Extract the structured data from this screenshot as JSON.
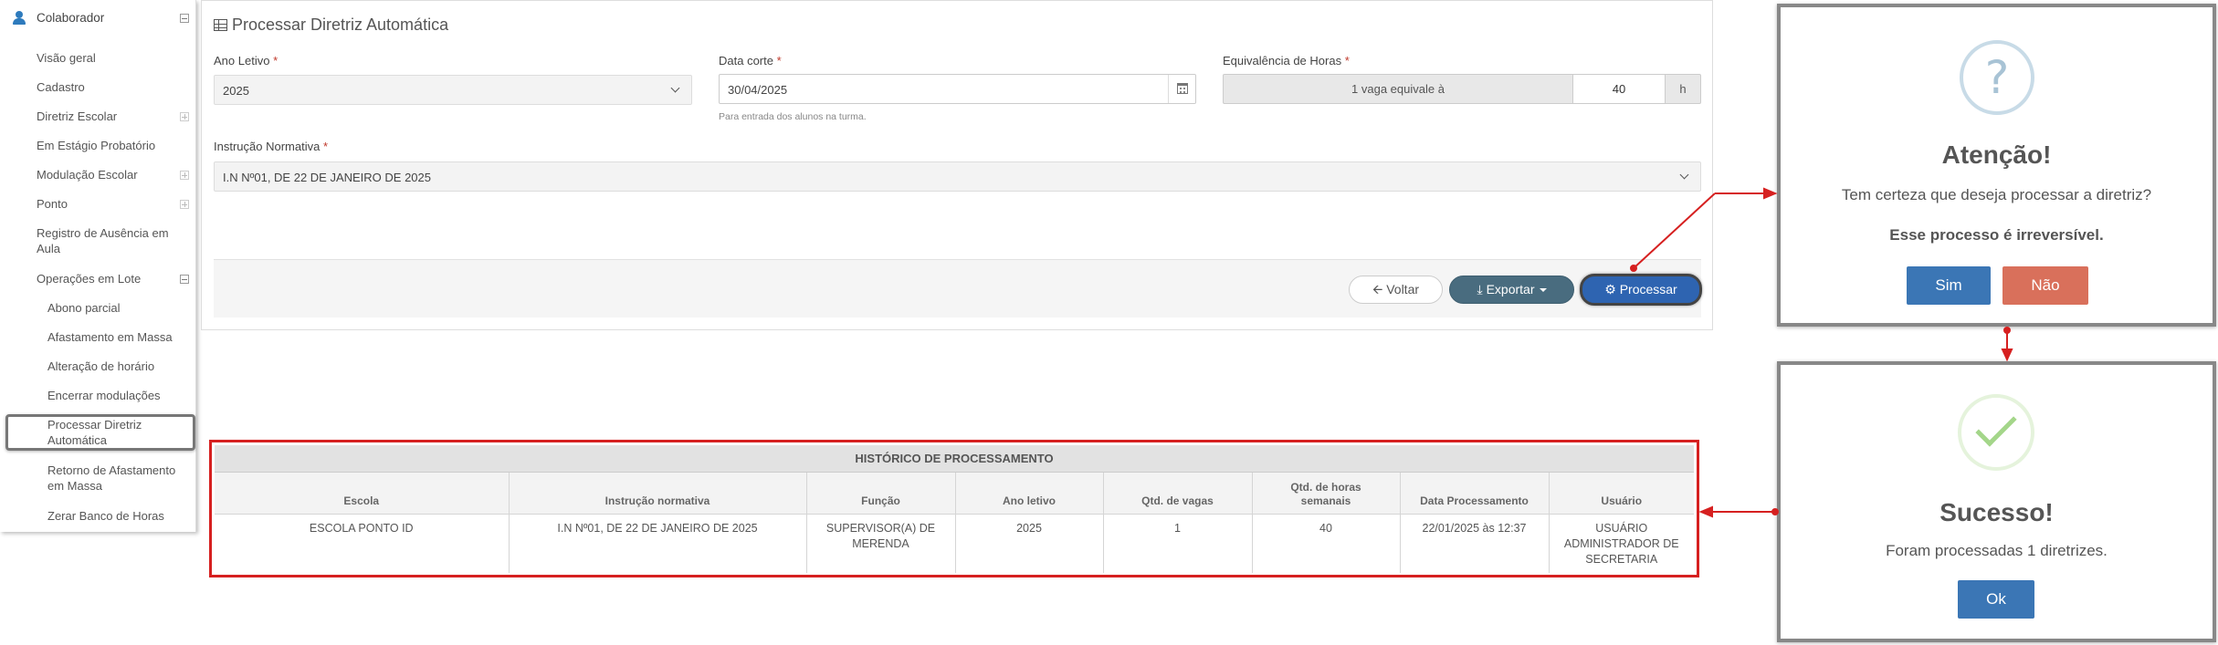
{
  "sidebar": {
    "header": "Colaborador",
    "items": [
      {
        "label": "Visão geral"
      },
      {
        "label": "Cadastro"
      },
      {
        "label": "Diretriz Escolar"
      },
      {
        "label": "Em Estágio Probatório"
      },
      {
        "label": "Modulação Escolar"
      },
      {
        "label": "Ponto"
      },
      {
        "label": "Registro de Ausência em Aula"
      },
      {
        "label": "Operações em Lote"
      }
    ],
    "subitems": [
      {
        "label": "Abono parcial"
      },
      {
        "label": "Afastamento em Massa"
      },
      {
        "label": "Alteração de horário"
      },
      {
        "label": "Encerrar modulações"
      },
      {
        "label": "Processar Diretriz Automática"
      },
      {
        "label": "Retorno de Afastamento em Massa"
      },
      {
        "label": "Zerar Banco de Horas"
      }
    ]
  },
  "form": {
    "title": "Processar Diretriz Automática",
    "ano_letivo": {
      "label": "Ano Letivo",
      "value": "2025"
    },
    "data_corte": {
      "label": "Data corte",
      "value": "30/04/2025",
      "hint": "Para entrada dos alunos na turma."
    },
    "equivalencia": {
      "label": "Equivalência de Horas",
      "prefix": "1 vaga equivale à",
      "value": "40",
      "unit": "h"
    },
    "instrucao": {
      "label": "Instrução Normativa",
      "value": "I.N Nº01, DE 22 DE JANEIRO DE 2025"
    },
    "required_mark": "*",
    "buttons": {
      "voltar": "Voltar",
      "exportar": "Exportar",
      "processar": "Processar"
    }
  },
  "history": {
    "title": "HISTÓRICO DE PROCESSAMENTO",
    "columns": [
      "Escola",
      "Instrução normativa",
      "Função",
      "Ano letivo",
      "Qtd. de vagas",
      "Qtd. de horas semanais",
      "Data Processamento",
      "Usuário"
    ],
    "rows": [
      [
        "ESCOLA PONTO ID",
        "I.N Nº01, DE 22 DE JANEIRO DE 2025",
        "SUPERVISOR(A) DE MERENDA",
        "2025",
        "1",
        "40",
        "22/01/2025 às 12:37",
        "USUÁRIO ADMINISTRADOR DE SECRETARIA"
      ]
    ]
  },
  "confirm_modal": {
    "icon_glyph": "?",
    "title": "Atenção!",
    "text": "Tem certeza que deseja processar a diretriz?",
    "strong_text": "Esse processo é irreversível.",
    "yes": "Sim",
    "no": "Não"
  },
  "success_modal": {
    "title": "Sucesso!",
    "text": "Foram processadas 1 diretrizes.",
    "ok": "Ok"
  },
  "colors": {
    "accent": "#2e64b1",
    "annotation": "#d62020",
    "danger_button": "#d9705b"
  }
}
